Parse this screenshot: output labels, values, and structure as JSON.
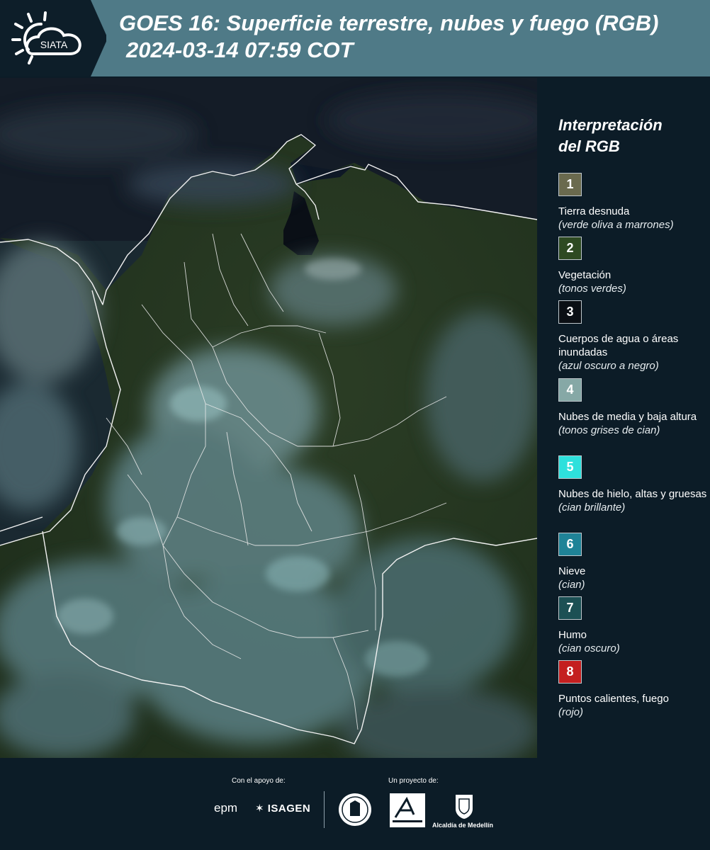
{
  "header": {
    "logo_text": "SIATA",
    "title_line1": "GOES 16: Superficie terrestre, nubes y fuego (RGB)",
    "title_line2": "2024-03-14 07:59 COT"
  },
  "legend": {
    "title_line1": "Interpretación",
    "title_line2": "del RGB",
    "items": [
      {
        "number": "1",
        "color": "#6a6a4e",
        "label": "Tierra desnuda",
        "desc": "(verde oliva a marrones)"
      },
      {
        "number": "2",
        "color": "#2e4a22",
        "label": "Vegetación",
        "desc": "(tonos verdes)"
      },
      {
        "number": "3",
        "color": "#0b0f14",
        "label": "Cuerpos de agua o áreas inundadas",
        "desc": "(azul oscuro a negro)"
      },
      {
        "number": "4",
        "color": "#86a8a6",
        "label": "Nubes de media y baja altura",
        "desc": "(tonos grises de cian)"
      },
      {
        "number": "5",
        "color": "#2ee0dc",
        "label": "Nubes de hielo, altas y gruesas",
        "desc": "(cian brillante)"
      },
      {
        "number": "6",
        "color": "#1f8397",
        "label": "Nieve",
        "desc": "(cian)"
      },
      {
        "number": "7",
        "color": "#1c5054",
        "label": "Humo",
        "desc": "(cian oscuro)"
      },
      {
        "number": "8",
        "color": "#c41f1f",
        "label": "Puntos calientes, fuego",
        "desc": "(rojo)"
      }
    ]
  },
  "footer": {
    "support_label": "Con el apoyo de:",
    "project_label": "Un proyecto de:",
    "sponsors": [
      "epm",
      "ISAGEN"
    ],
    "partners": [
      "Área Metropolitana Valle de Aburrá",
      "Alcaldía de Medellín"
    ],
    "medellin_label": "Alcaldía de Medellín"
  },
  "colors": {
    "header_bg": "#4f7a87",
    "dark_bg": "#0c1c27",
    "ocean": "#1b2a33",
    "land": "#24351f",
    "cloud": "#5e7f82",
    "border_line": "#f2f2f2"
  }
}
